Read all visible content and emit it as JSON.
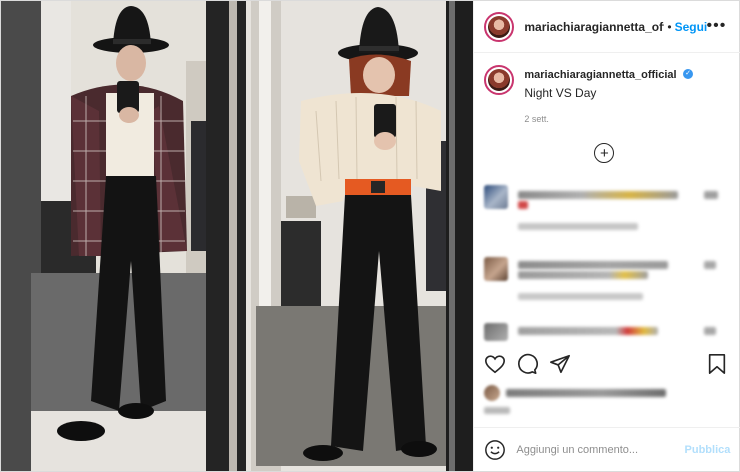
{
  "post": {
    "username": "mariachiaragiannetta_offic",
    "separator": "•",
    "follow_label": "Segui",
    "more_label": "•••",
    "caption_username": "mariachiaragiannetta_official",
    "verified_mark": "✓",
    "caption_text": "Night VS Day",
    "time_ago": "2 sett."
  },
  "comments": {
    "load_more_label": "+"
  },
  "add_comment": {
    "placeholder": "Aggiungi un commento...",
    "publish_label": "Pubblica"
  },
  "colors": {
    "follow": "#0095f6",
    "verified": "#3897f0",
    "publish_disabled": "#b2dffc",
    "avatar_ring": "#c9356e"
  },
  "icons": [
    "more-icon",
    "verified-icon",
    "plus-circle-icon",
    "heart-icon",
    "comment-icon",
    "share-icon",
    "bookmark-icon",
    "emoji-icon"
  ]
}
